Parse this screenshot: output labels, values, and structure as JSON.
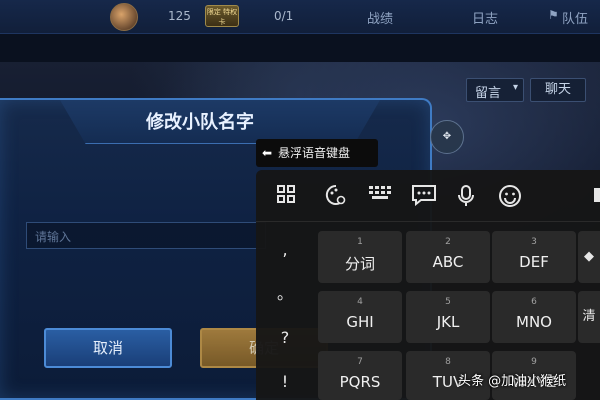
{
  "topbar": {
    "count_1": "125",
    "card_text": "限定 特权卡",
    "count_2": "0/1",
    "tabs": [
      "战绩",
      "日志",
      "队伍"
    ]
  },
  "chat_controls": {
    "message_label": "留言",
    "chat_label": "聊天"
  },
  "dialog": {
    "title": "修改小队名字",
    "input_placeholder": "请输入",
    "cancel_label": "取消",
    "confirm_label": "确定"
  },
  "keyboard": {
    "hint": "悬浮语音键盘",
    "toolbar_icons": [
      "grid-icon",
      "skin-palette-icon",
      "keyboard-icon",
      "chat-bubble-icon",
      "microphone-icon",
      "emoji-icon"
    ],
    "punctuation": [
      ",",
      "。",
      "?",
      "!"
    ],
    "keys": [
      {
        "num": "1",
        "label": "分词"
      },
      {
        "num": "2",
        "label": "ABC"
      },
      {
        "num": "3",
        "label": "DEF"
      },
      {
        "num": "4",
        "label": "GHI"
      },
      {
        "num": "5",
        "label": "JKL"
      },
      {
        "num": "6",
        "label": "MNO"
      },
      {
        "num": "7",
        "label": "PQRS"
      },
      {
        "num": "8",
        "label": "TUV"
      },
      {
        "num": "9",
        "label": "WXYZ"
      }
    ],
    "side_keys": [
      "◆",
      "清"
    ]
  },
  "watermark": "头条 @加油小猴纸"
}
